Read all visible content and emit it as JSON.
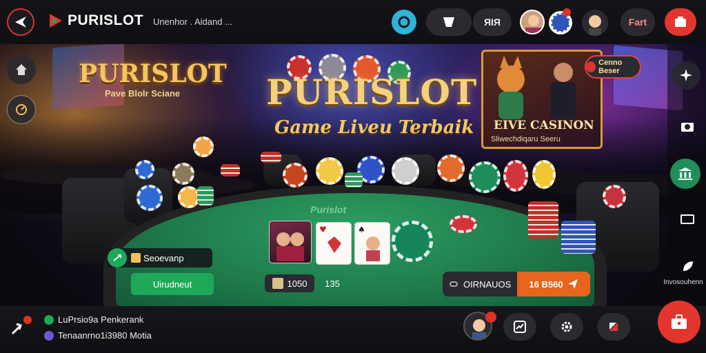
{
  "app": {
    "brand": "PURISLOT",
    "nav_sub": "Unenhor . Aidand ..."
  },
  "topbar": {
    "pill_text": "ЯIЯ",
    "right_pill": "Fart"
  },
  "promo": {
    "left_title": "PURISLOT",
    "left_subtitle": "Pave Blolr Sciane",
    "main_title": "PURISLOT",
    "main_subtitle": "Game Liveu Terbaik",
    "sign_title": "EIVE CASINON",
    "sign_subtitle": "Sliwechdiqaru Seeru",
    "badge_text": "Cenno Beser"
  },
  "table": {
    "felt_logo": "Purislot"
  },
  "controls": {
    "left_label": "Seoevanp",
    "green_button": "Uirudneut",
    "bet_amount": "1050",
    "bet_secondary": "135",
    "option_label": "OIRNAUOS",
    "orange_amount": "16 B560",
    "right_caption": "Invosouhenn"
  },
  "footer": {
    "line1": "LuPrsio9a Penkerank",
    "line2": "Tenaanrno1i3980 Motia"
  },
  "colors": {
    "accent_red": "#e2352e",
    "accent_green": "#1fa85a",
    "accent_orange": "#e5651c",
    "gold": "#f3c65e"
  },
  "icons": [
    "back-icon",
    "logo-icon",
    "home-icon",
    "history-icon",
    "chat-icon",
    "wallet-icon",
    "bell-icon",
    "settings-icon",
    "gift-icon",
    "camera-icon",
    "bank-icon",
    "tv-icon",
    "leaf-icon",
    "share-icon",
    "close-icon",
    "briefcase-icon"
  ]
}
